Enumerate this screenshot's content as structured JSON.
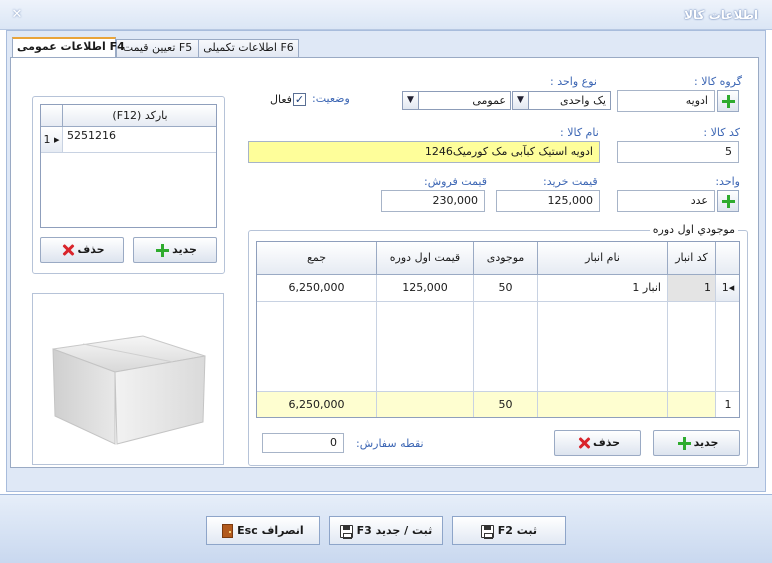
{
  "window": {
    "title": "اطلاعات كالا"
  },
  "tabs": [
    {
      "label": "اطلاعات عمومی F4",
      "active": true
    },
    {
      "label": "تعیین قیمت F5",
      "active": false
    },
    {
      "label": "اطلاعات تکمیلی F6",
      "active": false
    }
  ],
  "form": {
    "group_label": "گروه كالا :",
    "group_value": "ادویه",
    "unit_type_label": "نوع واحد :",
    "unit_type_value": "یک واحدی",
    "unit_kind_value": "عمومی",
    "status_label": "وضعیت:",
    "status_active_label": "فعال",
    "status_active_checked": true,
    "code_label": "كد كالا :",
    "code_value": "5",
    "name_label": "نام كالا :",
    "name_value": "ادویه استیک کبآبی مک کورمیک1246",
    "unit_label": "واحد:",
    "unit_value": "عدد",
    "buy_price_label": "قیمت خرید:",
    "buy_price_value": "125,000",
    "sell_price_label": "قیمت فروش:",
    "sell_price_value": "230,000"
  },
  "barcode": {
    "header": "(F12) باركد",
    "rows": [
      {
        "index": "1",
        "value": "5251216"
      }
    ],
    "new_label": "جدید",
    "delete_label": "حذف"
  },
  "stock": {
    "title": "موجودي اول دوره",
    "columns": [
      "كد انبار",
      "نام انبار",
      "موجودی",
      "قیمت اول دوره",
      "جمع"
    ],
    "rows": [
      {
        "index": "1",
        "code": "1",
        "name": "انبار 1",
        "qty": "50",
        "price": "125,000",
        "total": "6,250,000"
      }
    ],
    "footer": {
      "count": "1",
      "qty": "50",
      "total": "6,250,000"
    },
    "reorder_label": "نقطه سفارش:",
    "reorder_value": "0",
    "new_label": "جدید",
    "delete_label": "حذف"
  },
  "footer": {
    "save_label": "ثبت F2",
    "save_new_label": "ثبت / جدید F3",
    "cancel_label": "انصراف Esc"
  }
}
